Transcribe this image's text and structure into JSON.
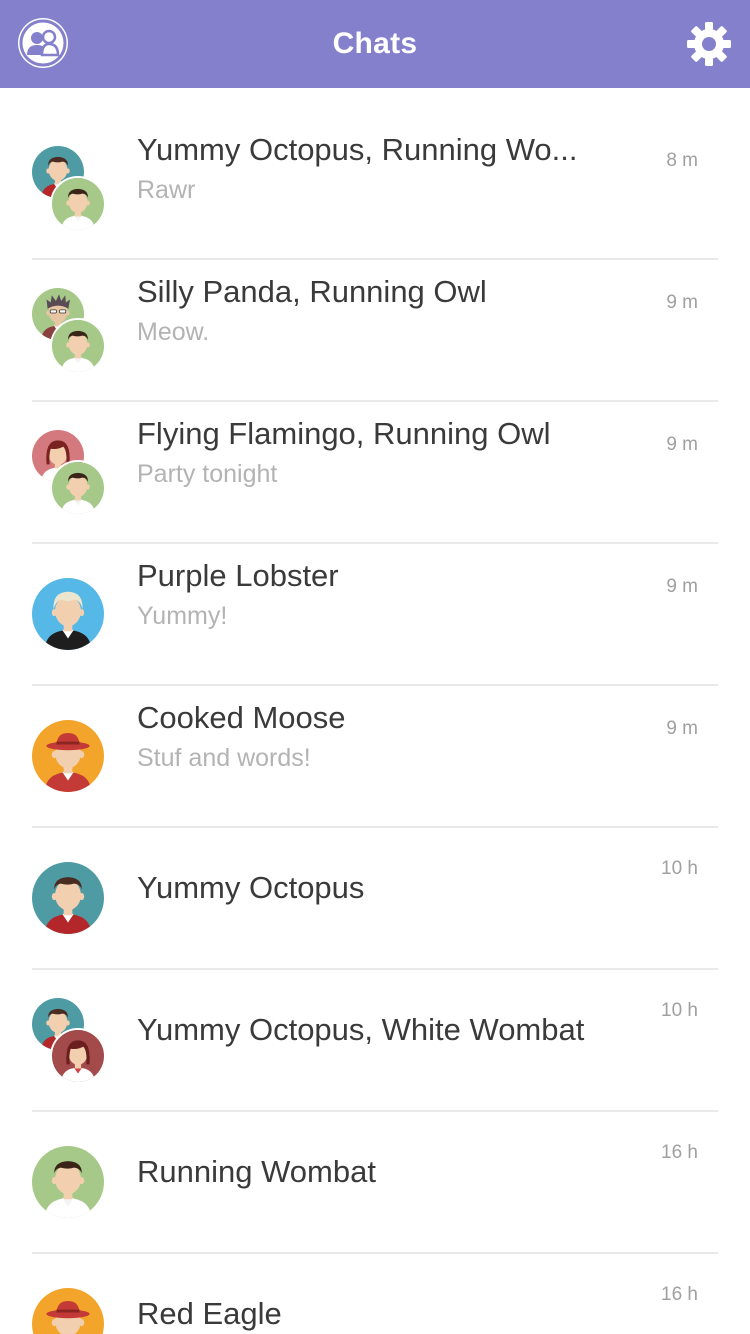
{
  "header": {
    "title": "Chats",
    "left_icon": "contacts-icon",
    "right_icon": "gear-icon",
    "bg_color": "#8580cc"
  },
  "chats": [
    {
      "title": "Yummy Octopus, Running Wo...",
      "preview": "Rawr",
      "time": "8 m",
      "avatars": [
        "teal-man",
        "green-man"
      ]
    },
    {
      "title": "Silly Panda, Running Owl",
      "preview": "Meow.",
      "time": "9 m",
      "avatars": [
        "green-spiky",
        "green-man"
      ]
    },
    {
      "title": "Flying Flamingo, Running Owl",
      "preview": "Party tonight",
      "time": "9 m",
      "avatars": [
        "pink-woman",
        "green-man"
      ]
    },
    {
      "title": "Purple Lobster",
      "preview": "Yummy!",
      "time": "9 m",
      "avatars": [
        "blue-blonde"
      ]
    },
    {
      "title": "Cooked Moose",
      "preview": "Stuf and words!",
      "time": "9 m",
      "avatars": [
        "orange-hat"
      ]
    },
    {
      "title": "Yummy Octopus",
      "preview": "",
      "time": "10 h",
      "avatars": [
        "teal-man"
      ]
    },
    {
      "title": "Yummy Octopus, White Wombat",
      "preview": "",
      "time": "10 h",
      "avatars": [
        "teal-man",
        "maroon-woman"
      ]
    },
    {
      "title": "Running Wombat",
      "preview": "",
      "time": "16 h",
      "avatars": [
        "green-man"
      ]
    },
    {
      "title": "Red Eagle",
      "preview": "",
      "time": "16 h",
      "avatars": [
        "orange-hat"
      ]
    }
  ]
}
